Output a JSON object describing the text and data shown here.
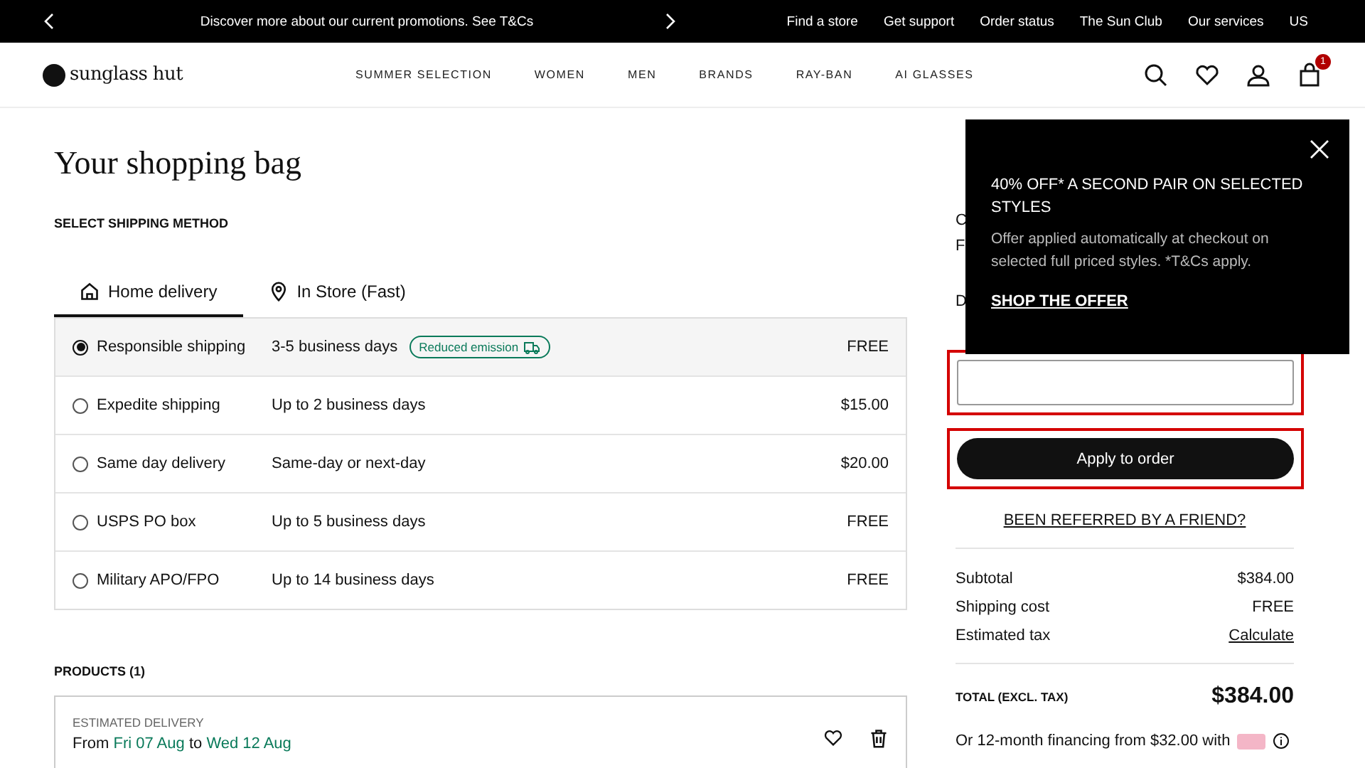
{
  "promo_bar": {
    "message": "Discover more about our current promotions. See T&Cs",
    "links": [
      "Find a store",
      "Get support",
      "Order status",
      "The Sun Club",
      "Our services",
      "US"
    ]
  },
  "header": {
    "logo": "sunglass hut",
    "nav": [
      "SUMMER SELECTION",
      "WOMEN",
      "MEN",
      "BRANDS",
      "RAY-BAN",
      "AI GLASSES"
    ],
    "cart_count": "1"
  },
  "page_title": "Your shopping bag",
  "shipping": {
    "heading": "SELECT SHIPPING METHOD",
    "tabs": [
      {
        "label": "Home delivery",
        "kind": "home",
        "selected": true
      },
      {
        "label": "In Store (Fast)",
        "kind": "pin",
        "selected": false
      }
    ],
    "options": [
      {
        "name": "Responsible shipping",
        "time": "3-5 business days",
        "badge": "Reduced emission",
        "price": "FREE",
        "selected": true
      },
      {
        "name": "Expedite shipping",
        "time": "Up to 2 business days",
        "price": "$15.00",
        "selected": false
      },
      {
        "name": "Same day delivery",
        "time": "Same-day or next-day",
        "price": "$20.00",
        "selected": false
      },
      {
        "name": "USPS PO box",
        "time": "Up to 5 business days",
        "price": "FREE",
        "selected": false
      },
      {
        "name": "Military APO/FPO",
        "time": "Up to 14 business days",
        "price": "FREE",
        "selected": false
      }
    ]
  },
  "products": {
    "heading": "PRODUCTS (1)",
    "delivery_label": "ESTIMATED DELIVERY",
    "delivery_from": "From",
    "delivery_start": "Fri 07 Aug",
    "delivery_to": "to",
    "delivery_end": "Wed 12 Aug"
  },
  "summary": {
    "hidden_letters": [
      "C",
      "F",
      "D"
    ],
    "code_field": {
      "highlighted": true
    },
    "apply_button": {
      "label": "Apply to order",
      "highlighted": true
    },
    "referral_link": "BEEN REFERRED BY A FRIEND?",
    "rows": [
      {
        "label": "Subtotal",
        "value": "$384.00",
        "kind": "text"
      },
      {
        "label": "Shipping cost",
        "value": "FREE",
        "kind": "text"
      },
      {
        "label": "Estimated tax",
        "value": "Calculate",
        "kind": "link"
      }
    ],
    "total_label": "TOTAL (EXCL. TAX)",
    "total": "$384.00",
    "financing": "Or 12-month financing from $32.00 with"
  },
  "offer_popup": {
    "title": "40% OFF* A SECOND PAIR ON SELECTED STYLES",
    "text": "Offer applied automatically at checkout on selected full priced styles. *T&Cs apply.",
    "link": "SHOP THE OFFER"
  }
}
